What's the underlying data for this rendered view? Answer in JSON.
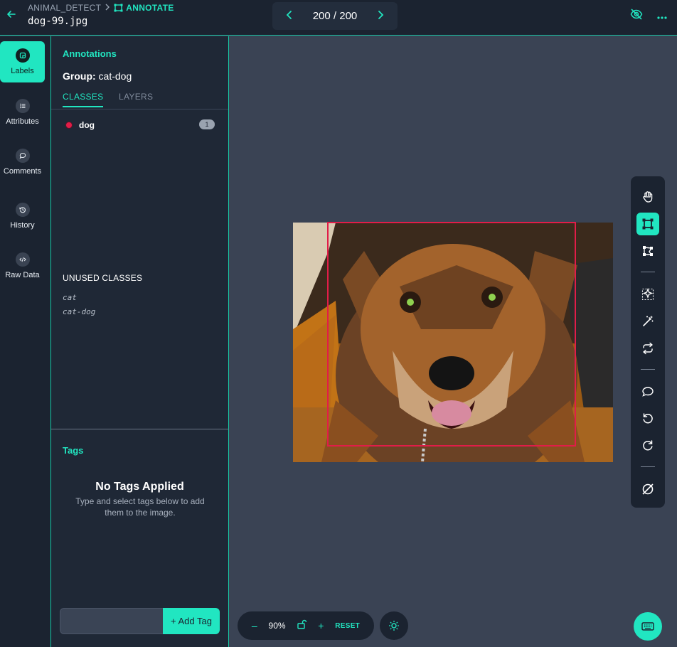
{
  "header": {
    "project": "ANIMAL_DETECT",
    "separator": ">",
    "mode": "ANNOTATE",
    "filename": "dog-99.jpg",
    "pager": "200 / 200"
  },
  "nav": {
    "items": [
      {
        "label": "Labels",
        "active": true
      },
      {
        "label": "Attributes"
      },
      {
        "label": "Comments"
      },
      {
        "label": "History"
      },
      {
        "label": "Raw Data"
      }
    ]
  },
  "panel": {
    "title": "Annotations",
    "group_label": "Group:",
    "group_value": "cat-dog",
    "tabs": [
      "CLASSES",
      "LAYERS"
    ],
    "classes": [
      {
        "name": "dog",
        "count": "1",
        "color": "#e11d48"
      }
    ],
    "unused_title": "UNUSED CLASSES",
    "unused": [
      "cat",
      "cat-dog"
    ]
  },
  "tags": {
    "title": "Tags",
    "empty_title": "No Tags Applied",
    "empty_sub": "Type and select tags below to add them to the image.",
    "input_value": "",
    "add_label": "+ Add Tag"
  },
  "zoom": {
    "minus": "–",
    "percent": "90%",
    "plus": "+",
    "reset": "RESET"
  },
  "colors": {
    "accent": "#21e6c1",
    "bbox": "#e11d48",
    "panel": "#1f2836",
    "canvas": "#3a4354"
  }
}
